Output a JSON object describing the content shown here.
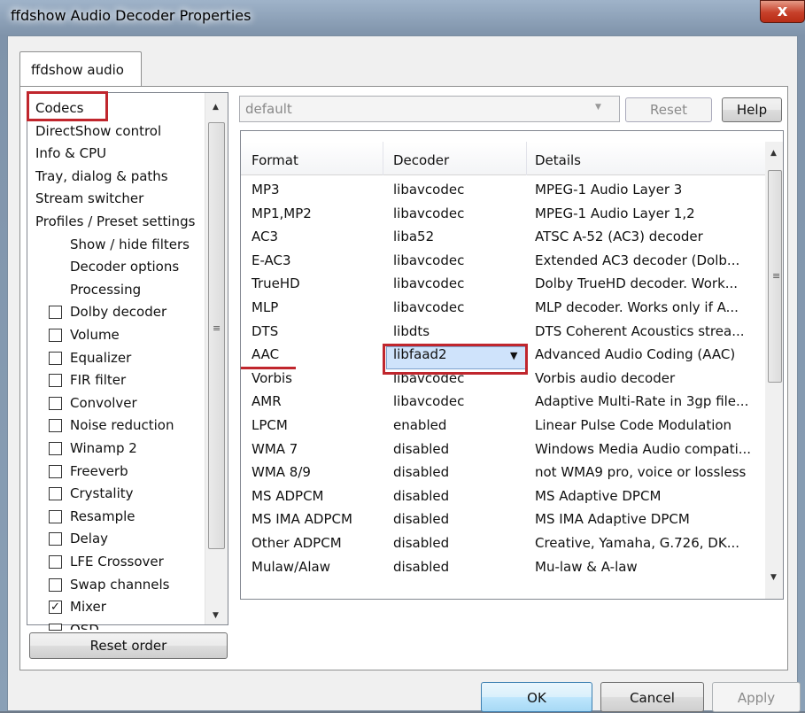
{
  "window": {
    "title": "ffdshow Audio Decoder Properties",
    "close_label": "x"
  },
  "tabs": [
    {
      "label": "ffdshow audio"
    }
  ],
  "preset": {
    "value": "default",
    "reset_label": "Reset",
    "help_label": "Help"
  },
  "nav": {
    "items": [
      {
        "label": "Codecs",
        "indent": 0
      },
      {
        "label": "DirectShow control",
        "indent": 0
      },
      {
        "label": "Info & CPU",
        "indent": 0
      },
      {
        "label": "Tray, dialog & paths",
        "indent": 0
      },
      {
        "label": "Stream switcher",
        "indent": 0
      },
      {
        "label": "Profiles / Preset settings",
        "indent": 0
      },
      {
        "label": "Show / hide filters",
        "indent": 1
      },
      {
        "label": "Decoder options",
        "indent": 1
      },
      {
        "label": "Processing",
        "indent": 1
      }
    ],
    "filters": [
      {
        "label": "Dolby decoder",
        "checked": false
      },
      {
        "label": "Volume",
        "checked": false
      },
      {
        "label": "Equalizer",
        "checked": false
      },
      {
        "label": "FIR filter",
        "checked": false
      },
      {
        "label": "Convolver",
        "checked": false
      },
      {
        "label": "Noise reduction",
        "checked": false
      },
      {
        "label": "Winamp 2",
        "checked": false
      },
      {
        "label": "Freeverb",
        "checked": false
      },
      {
        "label": "Crystality",
        "checked": false
      },
      {
        "label": "Resample",
        "checked": false
      },
      {
        "label": "Delay",
        "checked": false
      },
      {
        "label": "LFE Crossover",
        "checked": false
      },
      {
        "label": "Swap channels",
        "checked": false
      },
      {
        "label": "Mixer",
        "checked": true
      },
      {
        "label": "OSD",
        "checked": false
      }
    ],
    "reset_order_label": "Reset order"
  },
  "codec_table": {
    "headers": [
      "Format",
      "Decoder",
      "Details"
    ],
    "rows": [
      [
        "MP3",
        "libavcodec",
        "MPEG-1 Audio Layer 3"
      ],
      [
        "MP1,MP2",
        "libavcodec",
        "MPEG-1 Audio Layer 1,2"
      ],
      [
        "AC3",
        "liba52",
        "ATSC A-52 (AC3) decoder"
      ],
      [
        "E-AC3",
        "libavcodec",
        "Extended AC3 decoder (Dolb..."
      ],
      [
        "TrueHD",
        "libavcodec",
        "Dolby TrueHD decoder. Work..."
      ],
      [
        "MLP",
        "libavcodec",
        "MLP decoder. Works only if A..."
      ],
      [
        "DTS",
        "libdts",
        "DTS Coherent Acoustics strea..."
      ],
      [
        "AAC",
        "libfaad2",
        "Advanced Audio Coding (AAC)"
      ],
      [
        "Vorbis",
        "libavcodec",
        "Vorbis audio decoder"
      ],
      [
        "AMR",
        "libavcodec",
        "Adaptive Multi-Rate in 3gp file..."
      ],
      [
        "LPCM",
        "enabled",
        "Linear Pulse Code Modulation"
      ],
      [
        "WMA 7",
        "disabled",
        "Windows Media Audio compati..."
      ],
      [
        "WMA 8/9",
        "disabled",
        "not WMA9 pro, voice or lossless"
      ],
      [
        "MS ADPCM",
        "disabled",
        "MS Adaptive DPCM"
      ],
      [
        "MS IMA ADPCM",
        "disabled",
        "MS IMA Adaptive DPCM"
      ],
      [
        "Other ADPCM",
        "disabled",
        "Creative, Yamaha, G.726, DK..."
      ],
      [
        "Mulaw/Alaw",
        "disabled",
        "Mu-law & A-law"
      ]
    ],
    "selected_row": 7
  },
  "buttons": {
    "ok": "OK",
    "cancel": "Cancel",
    "apply": "Apply"
  },
  "colors": {
    "highlight": "#c0262d",
    "selection": "#cfe3fb"
  }
}
